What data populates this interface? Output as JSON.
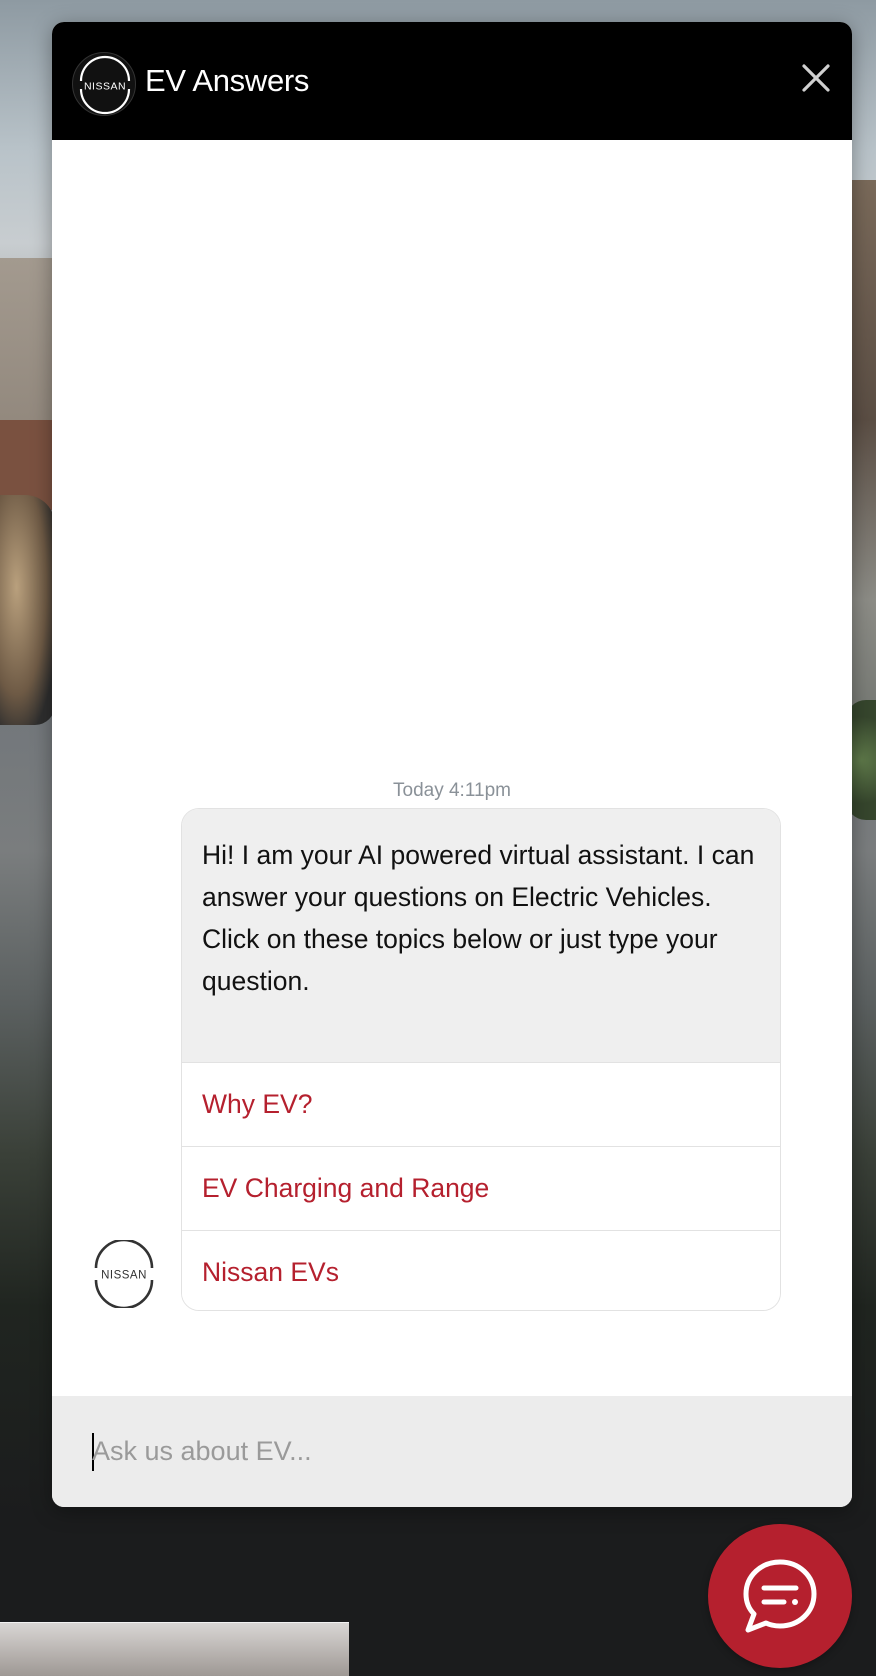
{
  "header": {
    "logo_text": "NISSAN",
    "title": "EV Answers",
    "close_icon": "close-icon"
  },
  "chat": {
    "timestamp": "Today 4:11pm",
    "message_lines": [
      "Hi! I am your AI powered virtual assistant. I can answer your questions on Electric Vehicles.",
      "Click on these topics below or just type your question."
    ],
    "quick_replies": [
      "Why EV?",
      "EV Charging and Range",
      "Nissan EVs"
    ],
    "bot_avatar_text": "NISSAN"
  },
  "input": {
    "placeholder": "Ask us about EV..."
  },
  "launcher": {
    "icon": "chat-bubble-icon"
  },
  "colors": {
    "accent": "#b5202e",
    "header_bg": "#000000",
    "bubble_bg": "#efefef",
    "input_bg": "#ececec"
  }
}
